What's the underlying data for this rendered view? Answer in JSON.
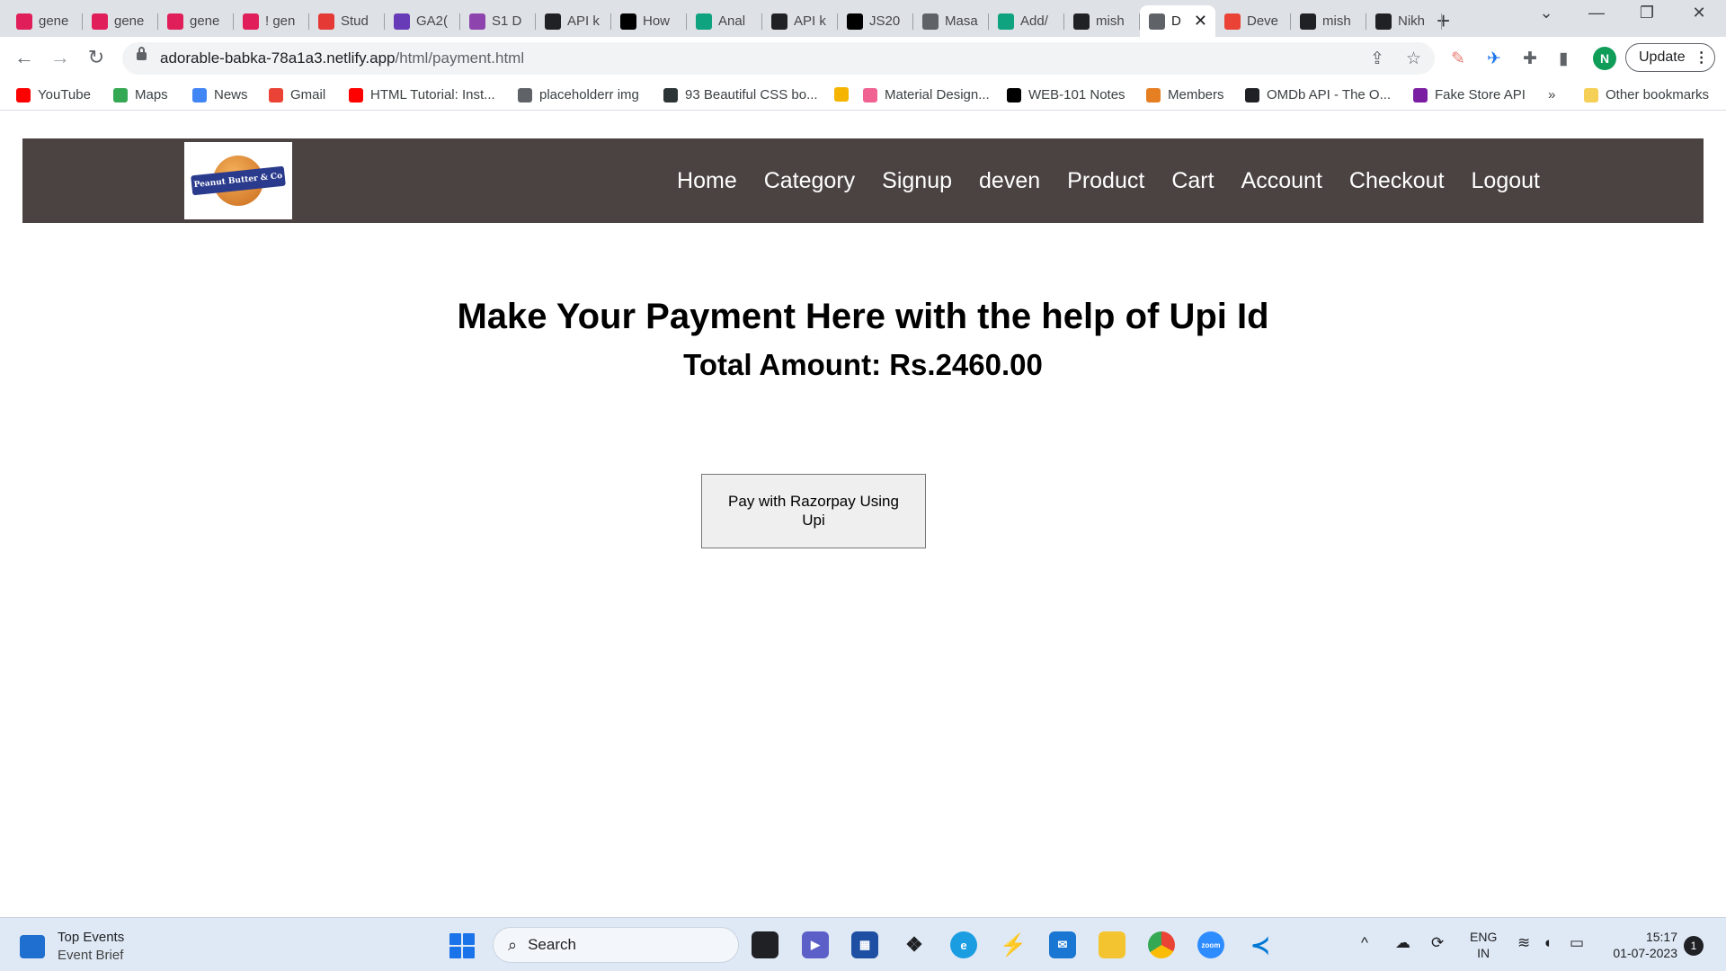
{
  "browser": {
    "tabs": [
      {
        "label": "gene",
        "icon": "slack-icon",
        "color": "#e01e5a"
      },
      {
        "label": "gene",
        "icon": "slack-icon",
        "color": "#e01e5a"
      },
      {
        "label": "gene",
        "icon": "slack-icon",
        "color": "#e01e5a"
      },
      {
        "label": "! gen",
        "icon": "slack-icon",
        "color": "#e01e5a"
      },
      {
        "label": "Stud",
        "icon": "apple-icon",
        "color": "#e53935"
      },
      {
        "label": "GA2(",
        "icon": "forms-icon",
        "color": "#673ab7"
      },
      {
        "label": "S1 D",
        "icon": "umbrella-icon",
        "color": "#8e44ad"
      },
      {
        "label": "API k",
        "icon": "openai-icon",
        "color": "#202124"
      },
      {
        "label": "How",
        "icon": "medium-icon",
        "color": "#000000"
      },
      {
        "label": "Anal",
        "icon": "chatgpt-icon",
        "color": "#10a37f"
      },
      {
        "label": "API k",
        "icon": "openai-icon",
        "color": "#202124"
      },
      {
        "label": "JS20",
        "icon": "notion-icon",
        "color": "#000000"
      },
      {
        "label": "Masa",
        "icon": "globe-icon",
        "color": "#5f6368"
      },
      {
        "label": "Add/",
        "icon": "chatgpt-icon",
        "color": "#10a37f"
      },
      {
        "label": "mish",
        "icon": "github-icon",
        "color": "#202124"
      },
      {
        "label": "D",
        "icon": "globe-icon",
        "color": "#5f6368",
        "active": true
      },
      {
        "label": "Deve",
        "icon": "gmail-icon",
        "color": "#ea4335"
      },
      {
        "label": "mish",
        "icon": "github-icon",
        "color": "#202124"
      },
      {
        "label": "Nikh",
        "icon": "briefcase-icon",
        "color": "#202124"
      }
    ],
    "url_host": "adorable-babka-78a1a3.netlify.app",
    "url_path": "/html/payment.html",
    "avatar_letter": "N",
    "update_label": "Update",
    "bookmarks": [
      {
        "label": "YouTube",
        "icon": "youtube-icon",
        "color": "#ff0000"
      },
      {
        "label": "Maps",
        "icon": "maps-icon",
        "color": "#34a853"
      },
      {
        "label": "News",
        "icon": "news-icon",
        "color": "#4285f4"
      },
      {
        "label": "Gmail",
        "icon": "gmail-icon",
        "color": "#ea4335"
      },
      {
        "label": "HTML Tutorial: Inst...",
        "icon": "youtube-icon",
        "color": "#ff0000"
      },
      {
        "label": "placeholderr img",
        "icon": "globe-icon",
        "color": "#5f6368"
      },
      {
        "label": "93 Beautiful CSS bo...",
        "icon": "css-icon",
        "color": "#2d3436"
      },
      {
        "label": "",
        "icon": "grid-icon",
        "color": "#f4b400"
      },
      {
        "label": "Material Design...",
        "icon": "material-icon",
        "color": "#f06292"
      },
      {
        "label": "WEB-101 Notes",
        "icon": "notion-icon",
        "color": "#000000"
      },
      {
        "label": "Members",
        "icon": "masai-icon",
        "color": "#e67e22"
      },
      {
        "label": "OMDb API - The O...",
        "icon": "film-icon",
        "color": "#202124"
      },
      {
        "label": "Fake Store API",
        "icon": "store-icon",
        "color": "#7b1fa2"
      }
    ],
    "more_bookmarks": "»",
    "other_bookmarks": "Other bookmarks"
  },
  "site": {
    "logo_text": "Peanut Butter & Co",
    "nav": [
      "Home",
      "Category",
      "Signup",
      "deven",
      "Product",
      "Cart",
      "Account",
      "Checkout",
      "Logout"
    ],
    "title": "Make Your Payment Here with the help of Upi Id",
    "total": "Total Amount: Rs.2460.00",
    "pay_button": "Pay with Razorpay Using Upi"
  },
  "taskbar": {
    "widget_title": "Top Events",
    "widget_sub": "Event Brief",
    "search_placeholder": "Search",
    "lang_top": "ENG",
    "lang_bottom": "IN",
    "time": "15:17",
    "date": "01-07-2023",
    "notifications": "1"
  }
}
